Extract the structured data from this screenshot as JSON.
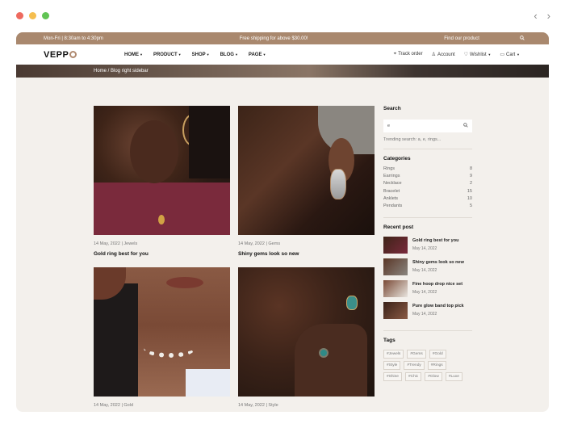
{
  "topbar": {
    "hours": "Mon-Fri | 8:30am to 4:30pm",
    "promo": "Free shipping for above $30.00!",
    "find": "Find our product"
  },
  "logo": {
    "text": "VEPP"
  },
  "menu": [
    {
      "label": "HOME"
    },
    {
      "label": "PRODUCT"
    },
    {
      "label": "SHOP"
    },
    {
      "label": "BLOG"
    },
    {
      "label": "PAGE"
    }
  ],
  "utils": {
    "track": "Track order",
    "account": "Account",
    "wishlist": "Wishlist",
    "cart": "Cart"
  },
  "breadcrumb": "Home / Blog right sidebar",
  "posts": [
    {
      "meta": "14 May, 2022 | Jewels",
      "title": "Gold ring best for you"
    },
    {
      "meta": "14 May, 2022 | Gems",
      "title": "Shiny gems look so new"
    },
    {
      "meta": "14 May, 2022 | Gold",
      "title": ""
    },
    {
      "meta": "14 May, 2022 | Style",
      "title": ""
    }
  ],
  "sidebar": {
    "search_title": "Search",
    "search_value": "e",
    "trending": "Trending search: a, e, rings...",
    "categories_title": "Categories",
    "categories": [
      {
        "name": "Rings",
        "count": "8"
      },
      {
        "name": "Earrings",
        "count": "9"
      },
      {
        "name": "Necklace",
        "count": "2"
      },
      {
        "name": "Bracelet",
        "count": "15"
      },
      {
        "name": "Anklets",
        "count": "10"
      },
      {
        "name": "Pendants",
        "count": "5"
      }
    ],
    "recent_title": "Recent post",
    "recent": [
      {
        "title": "Gold ring best for you",
        "date": "May 14, 2022"
      },
      {
        "title": "Shiny gems look so new",
        "date": "May 14, 2022"
      },
      {
        "title": "Fine hoop drop nice set",
        "date": "May 14, 2022"
      },
      {
        "title": "Pure glow band top pick",
        "date": "May 14, 2022"
      }
    ],
    "tags_title": "Tags",
    "tags": [
      "#Jewels",
      "#Gems",
      "#Gold",
      "#Style",
      "#Trendy",
      "#Rings",
      "#Shine",
      "#Chic",
      "#Glow",
      "#Luxe"
    ]
  },
  "colors": {
    "accent": "#a9886e",
    "background": "#f3f0ec"
  },
  "icons": {
    "search": "search-icon",
    "location": "location-icon",
    "user": "user-icon",
    "heart": "heart-icon",
    "cart": "cart-icon"
  }
}
